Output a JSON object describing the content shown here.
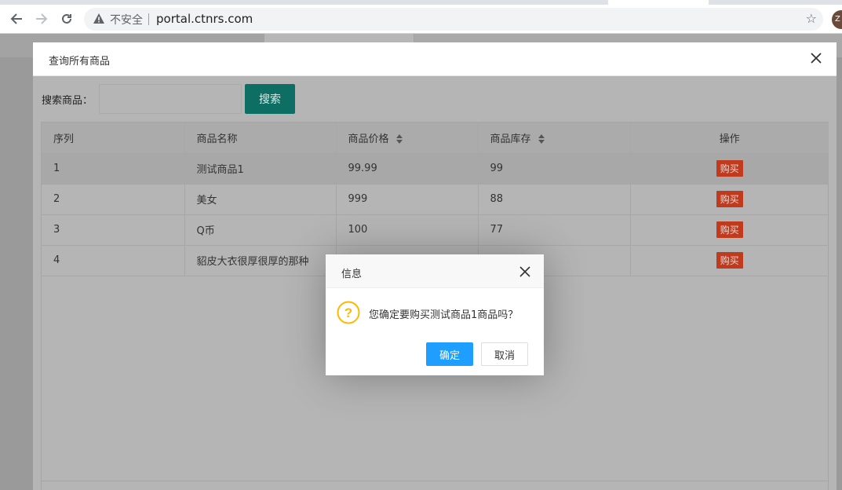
{
  "browser": {
    "security_label": "不安全",
    "url": "portal.ctnrs.com",
    "profile_initial": "Z"
  },
  "query_modal": {
    "title": "查询所有商品",
    "search_label": "搜索商品：",
    "search_placeholder": "",
    "search_button": "搜索",
    "columns": [
      "序列",
      "商品名称",
      "商品价格",
      "商品库存",
      "操作"
    ],
    "rows": [
      {
        "index": "1",
        "name": "测试商品1",
        "price": "99.99",
        "stock": "99",
        "action": "购买"
      },
      {
        "index": "2",
        "name": "美女",
        "price": "999",
        "stock": "88",
        "action": "购买"
      },
      {
        "index": "3",
        "name": "Q币",
        "price": "100",
        "stock": "77",
        "action": "购买"
      },
      {
        "index": "4",
        "name": "貂皮大衣很厚很厚的那种",
        "price": "",
        "stock": "",
        "action": "购买"
      }
    ]
  },
  "confirm_dialog": {
    "title": "信息",
    "message": "您确定要购买测试商品1商品吗？",
    "ok_label": "确定",
    "cancel_label": "取消"
  },
  "colors": {
    "search_button": "#009688",
    "buy_button": "#FF5722",
    "ok_button": "#1E9FFF",
    "question_icon": "#FFB800"
  }
}
